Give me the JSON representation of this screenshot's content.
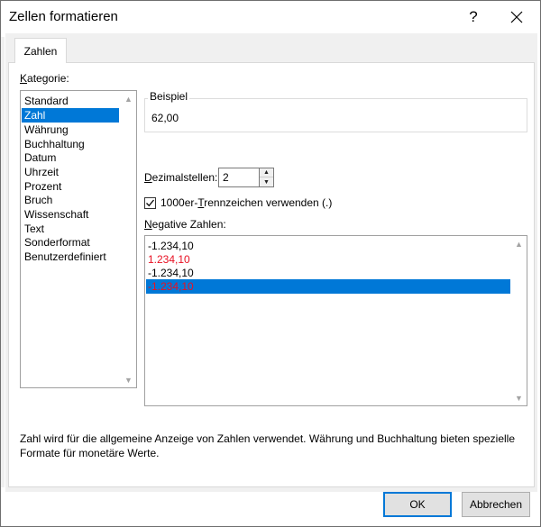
{
  "dialog": {
    "title": "Zellen formatieren",
    "help_glyph": "?",
    "close_icon": "close-icon"
  },
  "tabs": [
    {
      "label": "Zahlen",
      "active": true
    }
  ],
  "category": {
    "label_accel": "K",
    "label_rest": "ategorie:",
    "items": [
      "Standard",
      "Zahl",
      "Währung",
      "Buchhaltung",
      "Datum",
      "Uhrzeit",
      "Prozent",
      "Bruch",
      "Wissenschaft",
      "Text",
      "Sonderformat",
      "Benutzerdefiniert"
    ],
    "selected": "Zahl"
  },
  "sample": {
    "label": "Beispiel",
    "value": "62,00"
  },
  "decimals": {
    "label_accel": "D",
    "label_rest": "ezimalstellen:",
    "value": "2"
  },
  "thousands_separator": {
    "label_before": "1000er-",
    "label_accel": "T",
    "label_after": "rennzeichen verwenden (.)",
    "checked": true
  },
  "negative_numbers": {
    "label_accel": "N",
    "label_rest": "egative Zahlen:",
    "items": [
      {
        "text": "-1.234,10",
        "color": "#000000"
      },
      {
        "text": "1.234,10",
        "color": "#e81123"
      },
      {
        "text": "-1.234,10",
        "color": "#000000"
      },
      {
        "text": "-1.234,10",
        "color": "#e81123",
        "selected": true
      }
    ]
  },
  "description": "Zahl wird für die allgemeine Anzeige von Zahlen verwendet. Währung und Buchhaltung bieten spezielle Formate für monetäre Werte.",
  "buttons": {
    "ok": "OK",
    "cancel": "Abbrechen"
  },
  "colors": {
    "selection": "#0078d7",
    "negative_red": "#e81123"
  }
}
